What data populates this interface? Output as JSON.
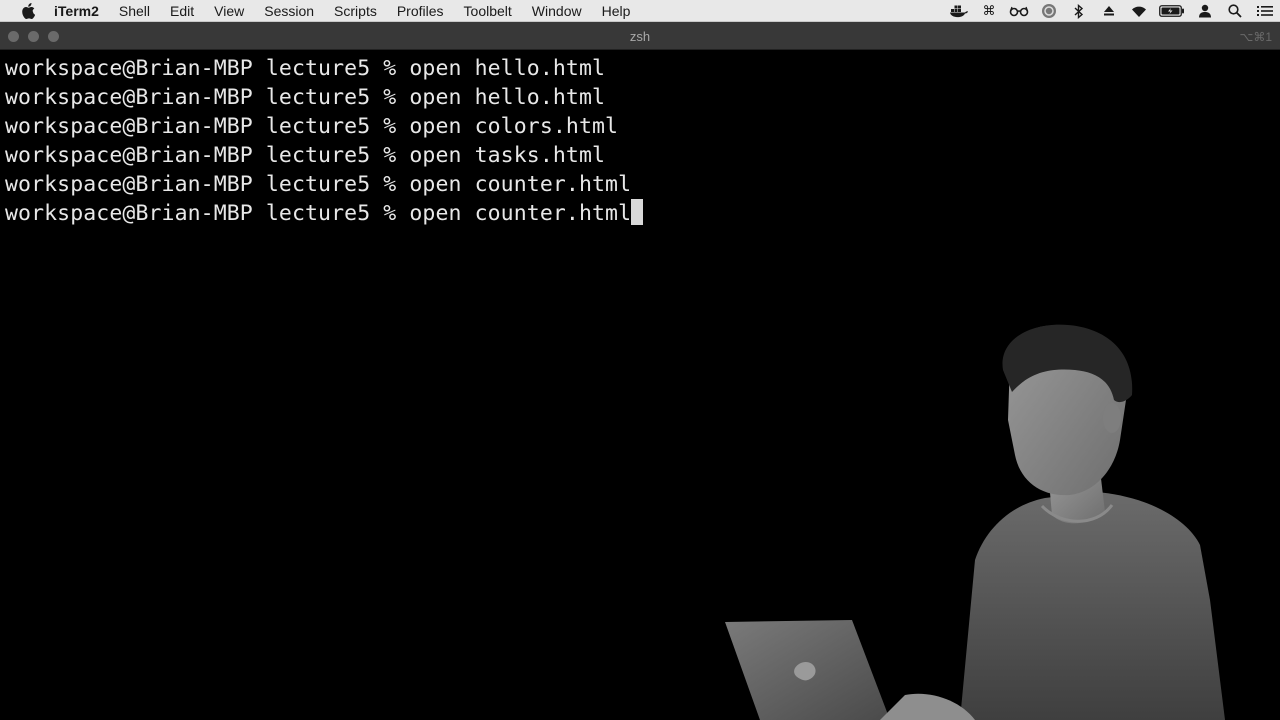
{
  "menubar": {
    "app_name": "iTerm2",
    "items": [
      "Shell",
      "Edit",
      "View",
      "Session",
      "Scripts",
      "Profiles",
      "Toolbelt",
      "Window",
      "Help"
    ],
    "status_icons": [
      "docker-icon",
      "command-icon",
      "glasses-icon",
      "circle-app-icon",
      "bluetooth-icon",
      "eject-icon",
      "wifi-icon",
      "battery-icon",
      "user-icon",
      "search-icon",
      "list-icon"
    ]
  },
  "window": {
    "title": "zsh",
    "shortcut": "⌥⌘1"
  },
  "terminal": {
    "lines": [
      {
        "prompt": "workspace@Brian-MBP lecture5 % ",
        "command": "open hello.html"
      },
      {
        "prompt": "workspace@Brian-MBP lecture5 % ",
        "command": "open hello.html"
      },
      {
        "prompt": "workspace@Brian-MBP lecture5 % ",
        "command": "open colors.html"
      },
      {
        "prompt": "workspace@Brian-MBP lecture5 % ",
        "command": "open tasks.html"
      },
      {
        "prompt": "workspace@Brian-MBP lecture5 % ",
        "command": "open counter.html"
      },
      {
        "prompt": "workspace@Brian-MBP lecture5 % ",
        "command": "open counter.html"
      }
    ]
  },
  "colors": {
    "terminal_bg": "#000000",
    "terminal_fg": "#e8e8e8",
    "menubar_bg": "#e8e8e8",
    "titlebar_bg": "#383838"
  }
}
